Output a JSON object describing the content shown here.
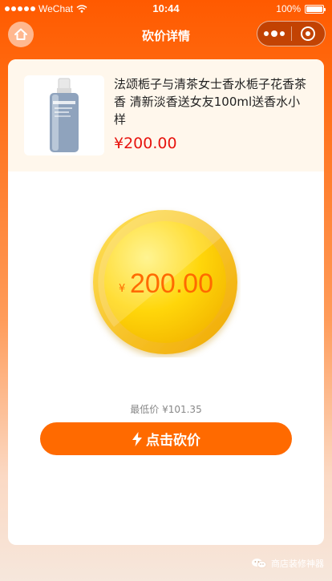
{
  "status_bar": {
    "carrier": "WeChat",
    "time": "10:44",
    "battery": "100%"
  },
  "nav": {
    "title": "砍价详情",
    "home_icon": "home-icon",
    "more_icon": "more-dots-icon",
    "target_icon": "target-icon"
  },
  "product": {
    "title": "法颂栀子与清茶女士香水栀子花香茶香 清新淡香送女友100ml送香水小样",
    "price": "¥200.00",
    "image_icon": "perfume-bottle-image"
  },
  "coin": {
    "currency": "¥",
    "amount": "200.00"
  },
  "lowest_price": "最低价 ¥101.35",
  "cta": {
    "label": "点击砍价",
    "icon": "lightning-icon"
  },
  "footer": {
    "label": "商店装修神器"
  },
  "colors": {
    "brand": "#ff5a00",
    "price": "#e7140e",
    "coin_text": "#ff6a00",
    "button": "#ff6a00"
  }
}
